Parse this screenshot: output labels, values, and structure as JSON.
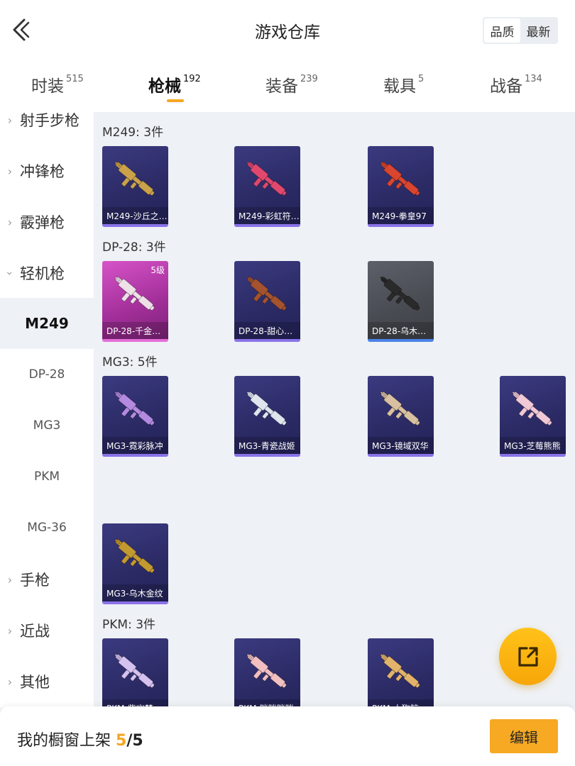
{
  "header": {
    "title": "游戏仓库",
    "sort_options": [
      "品质",
      "最新"
    ],
    "sort_active": "品质"
  },
  "tabs": [
    {
      "label": "时装",
      "count": "515"
    },
    {
      "label": "枪械",
      "count": "192",
      "active": true
    },
    {
      "label": "装备",
      "count": "239"
    },
    {
      "label": "载具",
      "count": "5"
    },
    {
      "label": "战备",
      "count": "134"
    }
  ],
  "sidebar": {
    "categories": [
      {
        "label": "射手步枪"
      },
      {
        "label": "冲锋枪"
      },
      {
        "label": "霰弹枪"
      },
      {
        "label": "轻机枪",
        "expanded": true
      },
      {
        "label": "手枪"
      },
      {
        "label": "近战"
      },
      {
        "label": "其他"
      }
    ],
    "subitems": [
      {
        "label": "M249",
        "active": true
      },
      {
        "label": "DP-28"
      },
      {
        "label": "MG3"
      },
      {
        "label": "PKM"
      },
      {
        "label": "MG-36"
      }
    ]
  },
  "groups": [
    {
      "title": "M249: 3件",
      "items": [
        {
          "name": "M249-沙丘之…",
          "style": "purple",
          "gun_color": "#c9a24a"
        },
        {
          "name": "M249-彩虹符…",
          "style": "purple",
          "gun_color": "#e0486e"
        },
        {
          "name": "M249-拳皇97",
          "style": "purple",
          "gun_color": "#d9452e"
        }
      ]
    },
    {
      "title": "DP-28: 3件",
      "items": [
        {
          "name": "DP-28-千金…",
          "style": "pink",
          "level": "5级",
          "gun_color": "#efe0e8"
        },
        {
          "name": "DP-28-甜心…",
          "style": "purple",
          "gun_color": "#a4532e"
        },
        {
          "name": "DP-28-乌木…",
          "style": "gray",
          "gun_color": "#2a2a2a"
        }
      ]
    },
    {
      "title": "MG3: 5件",
      "items": [
        {
          "name": "MG3-霓彩脉冲",
          "style": "purple",
          "gun_color": "#b48ae0"
        },
        {
          "name": "MG3-青瓷战姬",
          "style": "purple",
          "gun_color": "#dfe4ee"
        },
        {
          "name": "MG3-镜域双华",
          "style": "purple",
          "gun_color": "#d9c0a0"
        },
        {
          "name": "MG3-芝莓熊熊",
          "style": "purple",
          "gun_color": "#f1c8d6"
        },
        {
          "name": "MG3-乌木金纹",
          "style": "purple",
          "gun_color": "#c39a2f"
        }
      ]
    },
    {
      "title": "PKM: 3件",
      "items": [
        {
          "name": "PKM-紫幽梦…",
          "style": "purple",
          "gun_color": "#d6c2ef"
        },
        {
          "name": "PKM-咪咪咪咪…",
          "style": "purple",
          "gun_color": "#f2c0c0"
        },
        {
          "name": "PKM-小狗鲸…",
          "style": "purple",
          "gun_color": "#e2b36a"
        }
      ]
    }
  ],
  "bottom": {
    "label": "我的橱窗上架",
    "current": "5",
    "separator": "/",
    "total": "5",
    "edit_label": "编辑"
  },
  "icons": {
    "back": "chevron-left-icon",
    "fab": "share-external-icon",
    "chevron": "chevron-right-icon"
  },
  "colors": {
    "accent": "#f5a623",
    "card_purple": "#2b2a64",
    "card_pink": "#a12e98",
    "card_gray": "#484b52"
  }
}
